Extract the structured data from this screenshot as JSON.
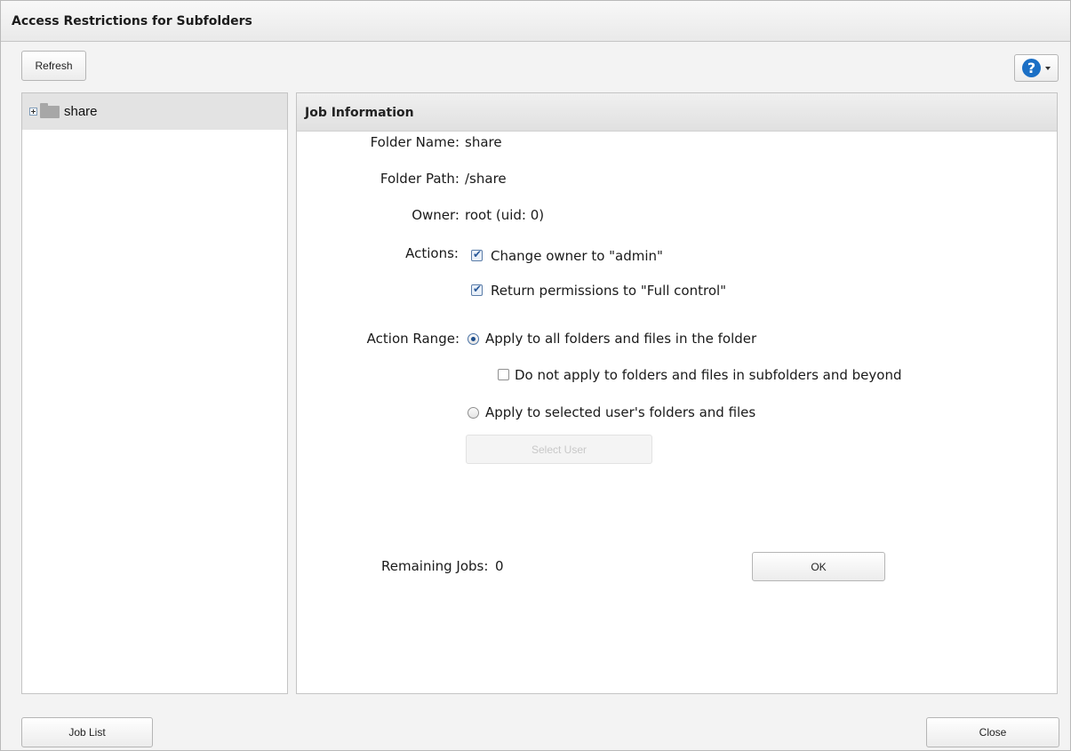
{
  "dialog": {
    "title": "Access Restrictions for Subfolders"
  },
  "toolbar": {
    "refresh_label": "Refresh",
    "help_icon_glyph": "?"
  },
  "tree": {
    "items": [
      {
        "label": "share",
        "icon": "folder-icon",
        "expanded": false
      }
    ]
  },
  "job_info": {
    "header": "Job Information",
    "folder_name_label": "Folder Name:",
    "folder_name_value": "share",
    "folder_path_label": "Folder Path:",
    "folder_path_value": "/share",
    "owner_label": "Owner:",
    "owner_value": "root (uid: 0)",
    "actions_label": "Actions:",
    "action_change_owner": "Change owner to \"admin\"",
    "action_change_owner_checked": true,
    "action_return_permissions": "Return permissions to \"Full control\"",
    "action_return_permissions_checked": true,
    "action_range_label": "Action Range:",
    "range_all": "Apply to all folders and files in the folder",
    "range_all_selected": true,
    "range_no_subfolders": "Do not apply to folders and files in subfolders and beyond",
    "range_no_subfolders_checked": false,
    "range_selected_user": "Apply to selected user's folders and files",
    "range_selected_user_selected": false,
    "select_user_label": "Select User",
    "remaining_jobs_label": "Remaining Jobs:",
    "remaining_jobs_value": "0",
    "ok_label": "OK"
  },
  "footer": {
    "job_list_label": "Job List",
    "close_label": "Close"
  },
  "colors": {
    "help_blue": "#1b6fc5",
    "panel_border": "#c4c4c4",
    "selected_row": "#e3e3e3"
  }
}
